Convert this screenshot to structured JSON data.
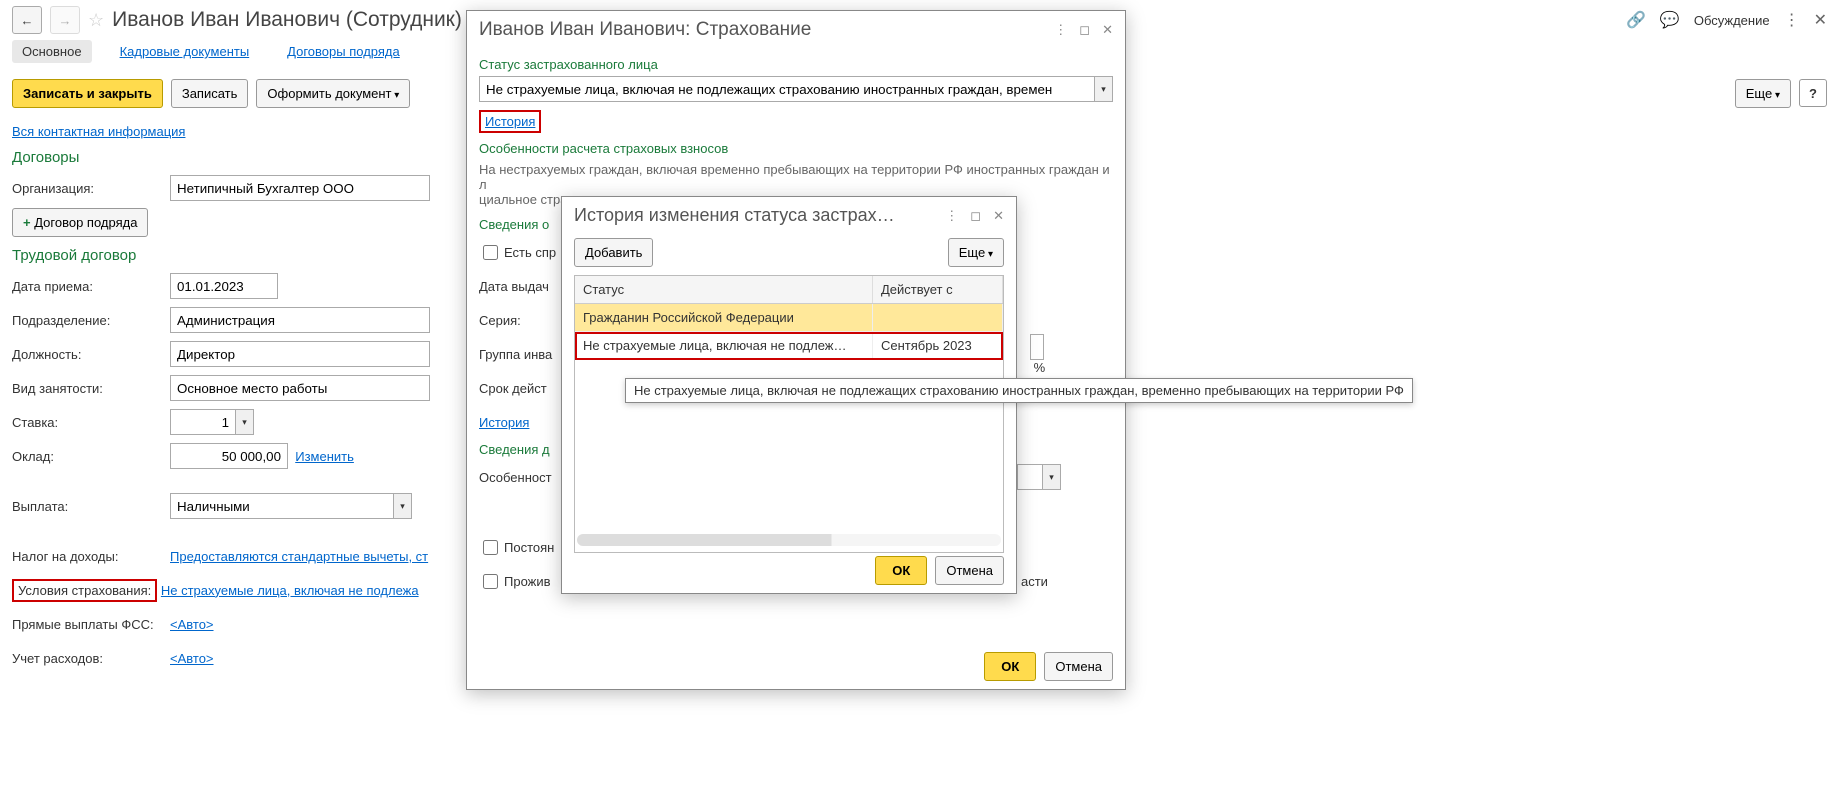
{
  "header": {
    "title": "Иванов Иван Иванович (Сотрудник)",
    "discussion": "Обсуждение"
  },
  "tabs": {
    "main": "Основное",
    "hr_docs": "Кадровые документы",
    "contracts": "Договоры подряда"
  },
  "cmd": {
    "save_close": "Записать и закрыть",
    "save": "Записать",
    "create_doc": "Оформить документ",
    "more": "Еще"
  },
  "links": {
    "all_contact": "Вся контактная информация",
    "change": "Изменить"
  },
  "sections": {
    "contracts": "Договоры",
    "employment": "Трудовой договор"
  },
  "labels": {
    "org": "Организация:",
    "hire_date": "Дата приема:",
    "dept": "Подразделение:",
    "position": "Должность:",
    "emp_type": "Вид занятости:",
    "rate": "Ставка:",
    "salary": "Оклад:",
    "payment": "Выплата:",
    "tax": "Налог на доходы:",
    "insurance": "Условия страхования:",
    "fss": "Прямые выплаты ФСС:",
    "expenses": "Учет расходов:",
    "add_contract": "Договор подряда"
  },
  "values": {
    "org": "Нетипичный Бухгалтер ООО",
    "hire_date": "01.01.2023",
    "dept": "Администрация",
    "position": "Директор",
    "emp_type": "Основное место работы",
    "rate": "1",
    "salary": "50 000,00",
    "payment": "Наличными",
    "tax": "Предоставляются стандартные вычеты, ст",
    "insurance": "Не страхуемые лица, включая не подлежа",
    "auto": "<Авто>"
  },
  "panel1": {
    "title": "Иванов Иван Иванович: Страхование",
    "status_label": "Статус застрахованного лица",
    "status_value": "Не страхуемые лица, включая не подлежащих страхованию иностранных граждан, времен",
    "history": "История",
    "calc_label": "Особенности расчета страховых взносов",
    "calc_text": "На нестрахуемых граждан, включая временно пребывающих на территории РФ иностранных граждан и л",
    "calc_text2": "циальное страховани",
    "info_label": "Сведения о",
    "has_cert": "Есть спр",
    "issue_date": "Дата выдач",
    "series": "Серия:",
    "inv_group": "Группа инва",
    "validity": "Срок дейст",
    "history2": "История",
    "extra_info": "Сведения д",
    "features": "Особенност",
    "percent": "%",
    "permanent": "Постоян",
    "resides": "Прожив",
    "resides_tail": "асти",
    "ok": "ОК",
    "cancel": "Отмена"
  },
  "panel2": {
    "title": "История изменения статуса застрах…",
    "add": "Добавить",
    "more": "Еще",
    "col_status": "Статус",
    "col_date": "Действует с",
    "row1_status": "Гражданин Российской Федерации",
    "row1_date": "",
    "row2_status": "Не страхуемые лица, включая не подлеж…",
    "row2_date": "Сентябрь 2023",
    "tooltip": "Не страхуемые лица, включая не подлежащих страхованию иностранных граждан, временно пребывающих на территории РФ",
    "ok": "ОК",
    "cancel": "Отмена"
  }
}
